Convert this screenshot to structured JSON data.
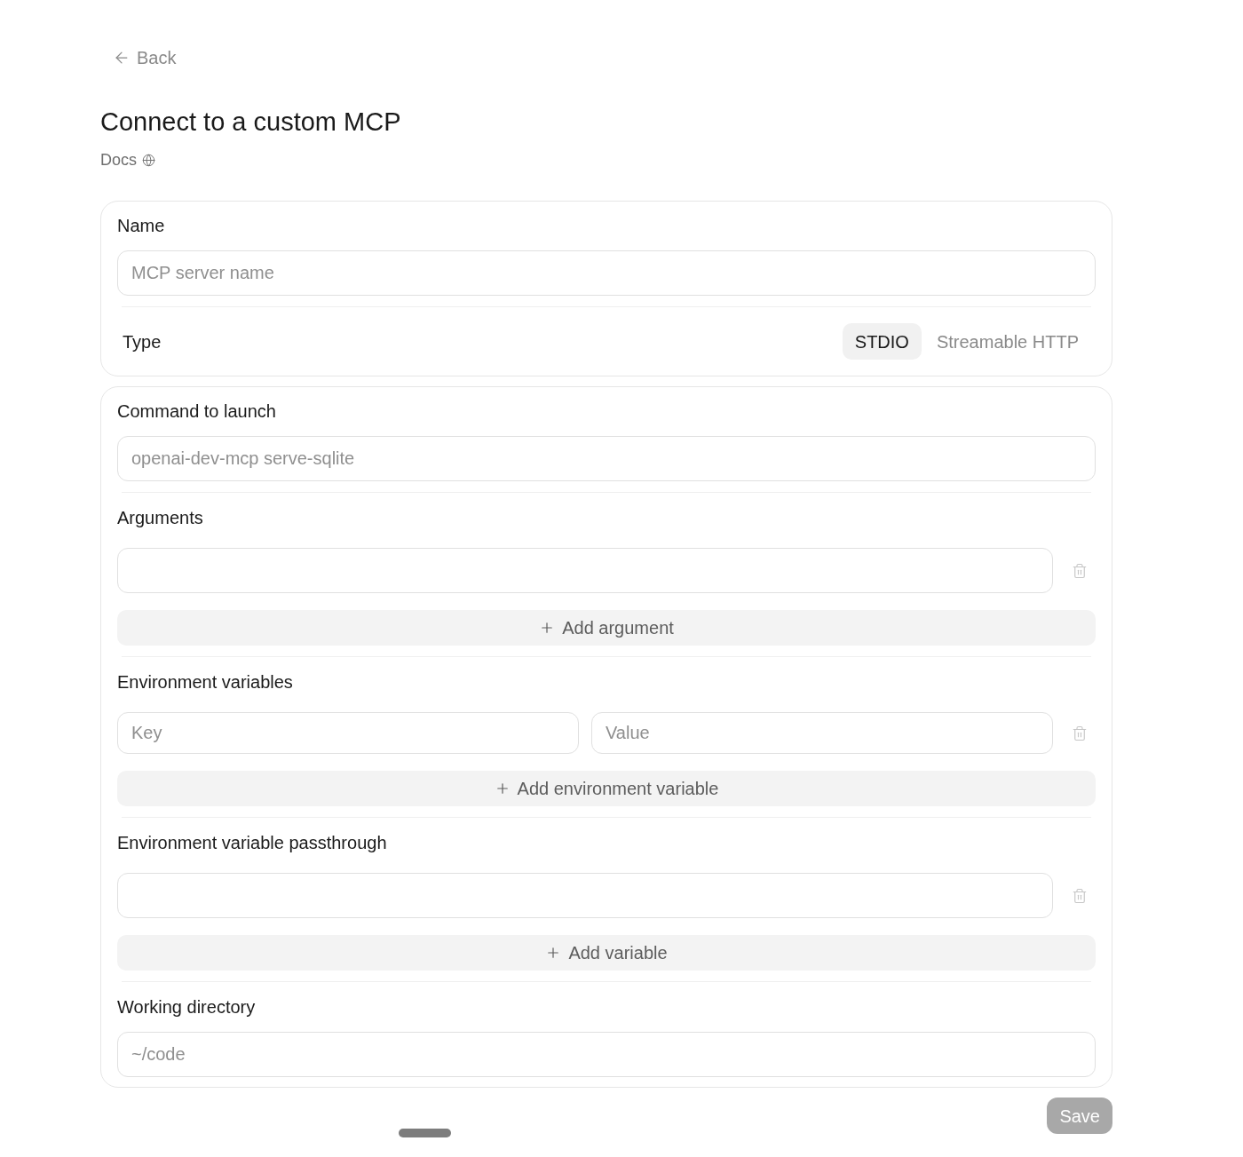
{
  "back_button": {
    "label": "Back"
  },
  "title": "Connect to a custom MCP",
  "docs_link": {
    "label": "Docs"
  },
  "server_card": {
    "name_field": {
      "label": "Name",
      "placeholder": "MCP server name"
    },
    "type": {
      "label": "Type",
      "options": [
        {
          "label": "STDIO",
          "selected": true
        },
        {
          "label": "Streamable HTTP",
          "selected": false
        }
      ]
    }
  },
  "launch_card": {
    "sections": [
      {
        "kind": "text",
        "label": "Command to launch",
        "placeholder": "openai-dev-mcp serve-sqlite"
      },
      {
        "kind": "list",
        "label": "Arguments",
        "add_label": "Add argument"
      },
      {
        "kind": "pairs",
        "label": "Environment variables",
        "rows": [
          {
            "key_placeholder": "Key",
            "value_placeholder": "Value"
          }
        ],
        "add_label": "Add environment variable"
      },
      {
        "kind": "list",
        "label": "Environment variable passthrough",
        "add_label": "Add variable"
      },
      {
        "kind": "text",
        "label": "Working directory",
        "placeholder": "~/code"
      }
    ]
  },
  "save_button": {
    "label": "Save",
    "disabled": true
  }
}
